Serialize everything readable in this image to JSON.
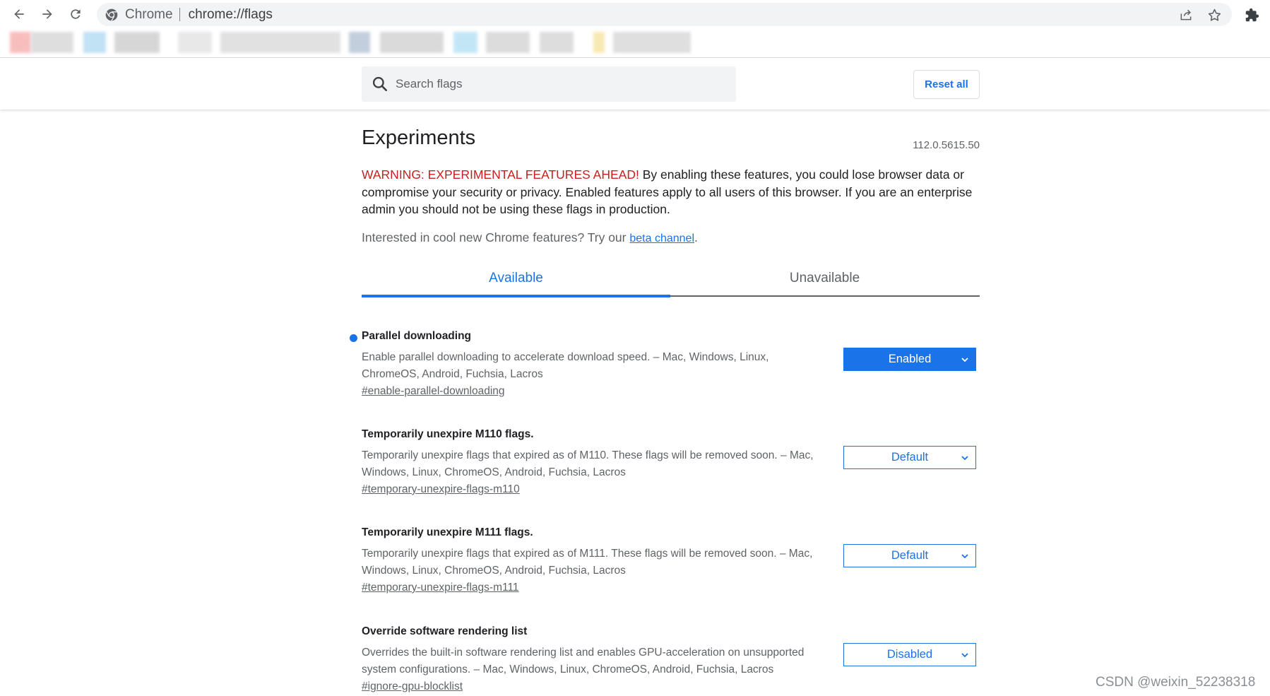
{
  "browser": {
    "site_name": "Chrome",
    "url": "chrome://flags"
  },
  "header": {
    "search_placeholder": "Search flags",
    "reset_label": "Reset all"
  },
  "page": {
    "title": "Experiments",
    "version": "112.0.5615.50",
    "warning_label": "WARNING: EXPERIMENTAL FEATURES AHEAD!",
    "warning_text": " By enabling these features, you could lose browser data or compromise your security or privacy. Enabled features apply to all users of this browser. If you are an enterprise admin you should not be using these flags in production.",
    "beta_prefix": "Interested in cool new Chrome features? Try our ",
    "beta_link": "beta channel",
    "beta_suffix": ".",
    "tabs": [
      {
        "label": "Available"
      },
      {
        "label": "Unavailable"
      }
    ]
  },
  "flags": [
    {
      "name": "Parallel downloading",
      "description": "Enable parallel downloading to accelerate download speed. – Mac, Windows, Linux, ChromeOS, Android, Fuchsia, Lacros",
      "link": "#enable-parallel-downloading",
      "value": "Enabled"
    },
    {
      "name": "Temporarily unexpire M110 flags.",
      "description": "Temporarily unexpire flags that expired as of M110. These flags will be removed soon. – Mac, Windows, Linux, ChromeOS, Android, Fuchsia, Lacros",
      "link": "#temporary-unexpire-flags-m110",
      "value": "Default"
    },
    {
      "name": "Temporarily unexpire M111 flags.",
      "description": "Temporarily unexpire flags that expired as of M111. These flags will be removed soon. – Mac, Windows, Linux, ChromeOS, Android, Fuchsia, Lacros",
      "link": "#temporary-unexpire-flags-m111",
      "value": "Default"
    },
    {
      "name": "Override software rendering list",
      "description": "Overrides the built-in software rendering list and enables GPU-acceleration on unsupported system configurations. – Mac, Windows, Linux, ChromeOS, Android, Fuchsia, Lacros",
      "link": "#ignore-gpu-blocklist",
      "value": "Disabled"
    }
  ],
  "watermark": "CSDN @weixin_52238318",
  "colors": {
    "accent": "#1a73e8",
    "warning": "#c5221f"
  }
}
